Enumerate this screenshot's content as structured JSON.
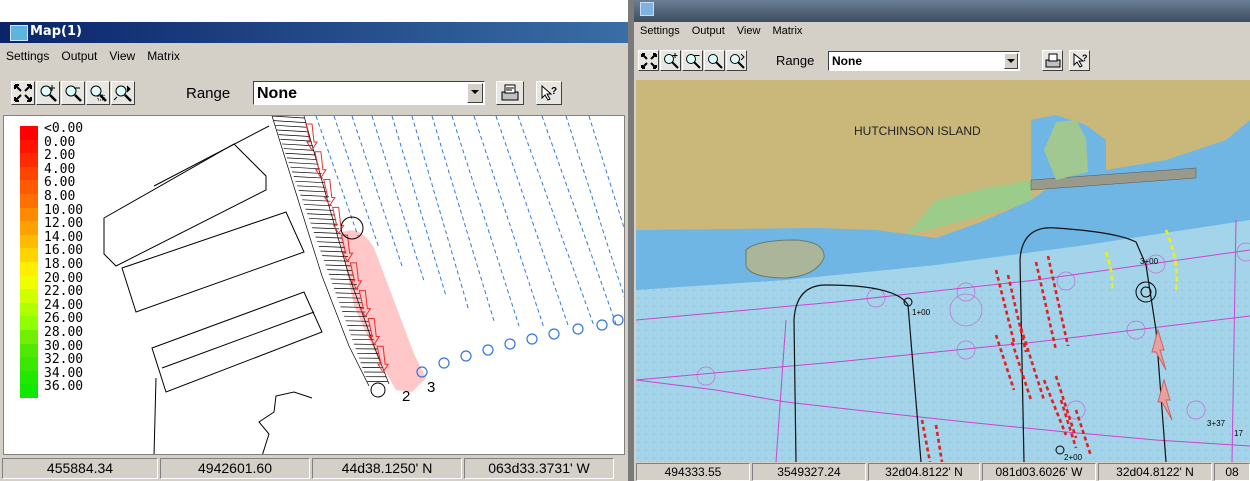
{
  "left_window": {
    "title": "Map(1)",
    "menu": [
      "Settings",
      "Output",
      "View",
      "Matrix"
    ],
    "toolbar": {
      "icons": [
        "zoom-extents-icon",
        "zoom-in-icon",
        "zoom-out-icon",
        "zoom-window-icon",
        "pan-icon",
        "print-icon",
        "query-icon"
      ],
      "range_label": "Range",
      "range_value": "None"
    },
    "legend": {
      "labels": [
        "<0.00",
        "0.00",
        "2.00",
        "4.00",
        "6.00",
        "8.00",
        "10.00",
        "12.00",
        "14.00",
        "16.00",
        "18.00",
        "20.00",
        "22.00",
        "24.00",
        "26.00",
        "28.00",
        "30.00",
        "32.00",
        "34.00",
        "36.00"
      ],
      "colors": [
        "#ff0000",
        "#ff1400",
        "#ff2a00",
        "#ff4400",
        "#ff5a00",
        "#ff7000",
        "#ff8a00",
        "#ffa200",
        "#ffbb00",
        "#ffd400",
        "#ffee00",
        "#f0ff00",
        "#d0ff00",
        "#b0ff00",
        "#90ff00",
        "#70f000",
        "#50e800",
        "#38e800",
        "#20e800",
        "#10e800"
      ]
    },
    "map_labels": [
      "2",
      "3"
    ],
    "status": [
      "455884.34",
      "4942601.60",
      "44d38.1250' N",
      "063d33.3731' W"
    ]
  },
  "right_window": {
    "menu": [
      "Settings",
      "Output",
      "View",
      "Matrix"
    ],
    "toolbar": {
      "range_label": "Range",
      "range_value": "None"
    },
    "map_labels": {
      "island": "HUTCHINSON ISLAND",
      "sta1": "1+00",
      "sta2": "2+00",
      "sta3": "3+00",
      "sta4": "3+37",
      "sta5": "17"
    },
    "colors": {
      "water_deep": "#a4d4ea",
      "water_river": "#6fb6e5",
      "land": "#c9b87a",
      "vegetation": "#9ccc8a"
    },
    "status": [
      "494333.55",
      "3549327.24",
      "32d04.8122' N",
      "081d03.6026' W",
      "32d04.8122' N",
      "08"
    ]
  }
}
